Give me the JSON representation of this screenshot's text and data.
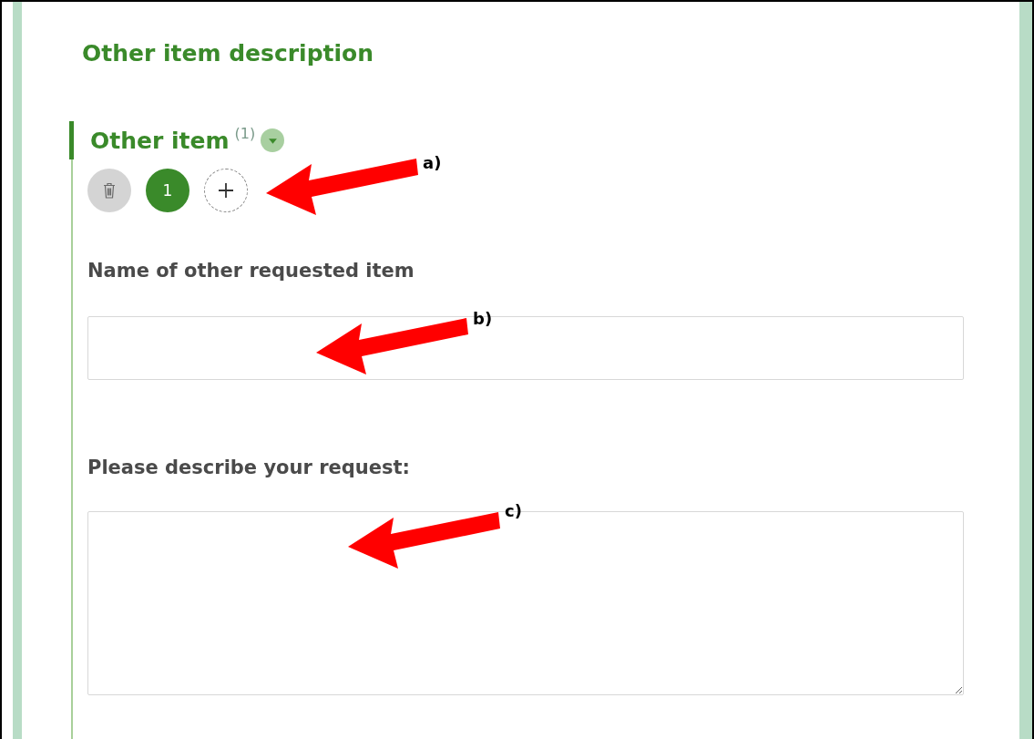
{
  "section": {
    "title": "Other item description"
  },
  "group": {
    "title": "Other item",
    "count": "(1)",
    "expanded": true,
    "entries": [
      {
        "label": "1",
        "selected": true
      }
    ],
    "fields": [
      {
        "kind": "input",
        "label": "Name of other requested item"
      },
      {
        "kind": "textarea",
        "label": "Please describe your request:"
      }
    ]
  },
  "annotations": [
    {
      "label": "a)"
    },
    {
      "label": "b)"
    },
    {
      "label": "c)"
    }
  ]
}
